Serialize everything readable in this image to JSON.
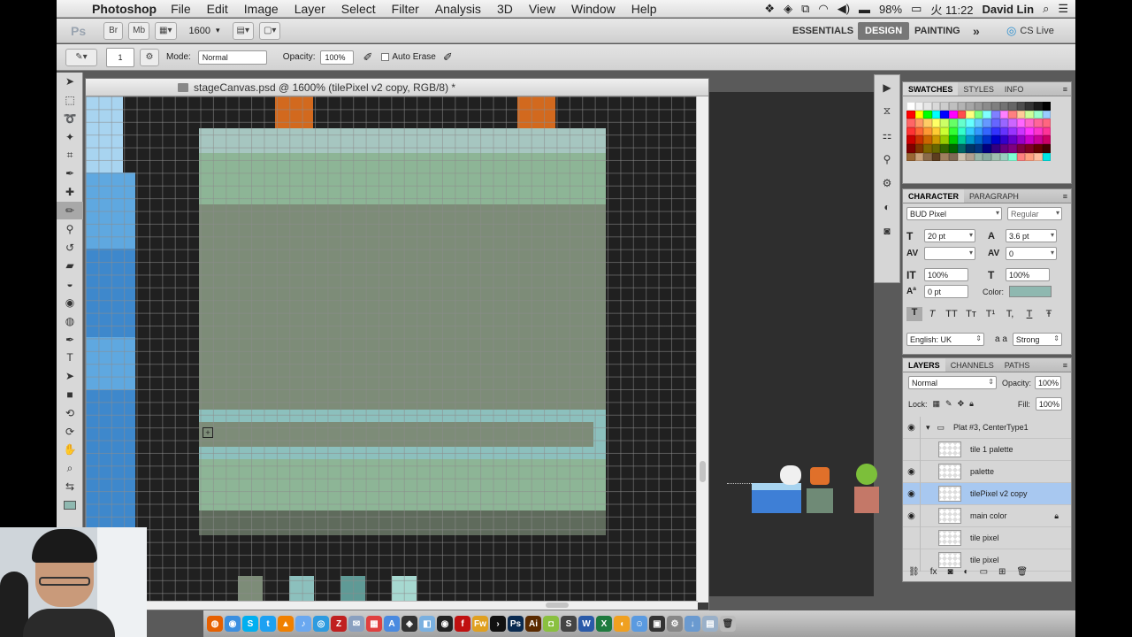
{
  "menubar": {
    "app": "Photoshop",
    "items": [
      "File",
      "Edit",
      "Image",
      "Layer",
      "Select",
      "Filter",
      "Analysis",
      "3D",
      "View",
      "Window",
      "Help"
    ],
    "battery": "98%",
    "clock": "火 11:22",
    "user": "David Lin"
  },
  "appbar": {
    "logo": "Ps",
    "br": "Br",
    "mb": "Mb",
    "zoom": "1600",
    "workspaces": [
      "ESSENTIALS",
      "DESIGN",
      "PAINTING"
    ],
    "more": "»",
    "cslive": "CS Live"
  },
  "options": {
    "brush_size": "1",
    "mode_label": "Mode:",
    "mode_value": "Normal",
    "opacity_label": "Opacity:",
    "opacity_value": "100%",
    "auto_erase": "Auto Erase"
  },
  "document": {
    "title": "stageCanvas.psd @ 1600% (tilePixel v2 copy, RGB/8) *"
  },
  "swatches_panel": {
    "tabs": [
      "SWATCHES",
      "STYLES",
      "INFO"
    ],
    "colors": [
      "#ffffff",
      "#f2f2f2",
      "#e6e6e6",
      "#d9d9d9",
      "#cccccc",
      "#bfbfbf",
      "#b3b3b3",
      "#a6a6a6",
      "#999999",
      "#8c8c8c",
      "#7f7f7f",
      "#737373",
      "#666666",
      "#4d4d4d",
      "#333333",
      "#1a1a1a",
      "#000000",
      "#ff0000",
      "#ffff00",
      "#00ff00",
      "#00ffff",
      "#0000ff",
      "#ff00ff",
      "#ff4d4d",
      "#ffff80",
      "#80ff80",
      "#80ffff",
      "#8080ff",
      "#ff80ff",
      "#ff8080",
      "#ffcc99",
      "#ccff99",
      "#99ffcc",
      "#99ccff",
      "#ff6666",
      "#ff9966",
      "#ffcc66",
      "#ffff66",
      "#ccff66",
      "#66ff66",
      "#66ffcc",
      "#66ffff",
      "#66ccff",
      "#6699ff",
      "#6666ff",
      "#9966ff",
      "#cc66ff",
      "#ff66ff",
      "#ff66cc",
      "#ff6699",
      "#ff6680",
      "#ff3333",
      "#ff6633",
      "#ff9933",
      "#ffcc33",
      "#ccff33",
      "#33ff33",
      "#33ffcc",
      "#33ccff",
      "#3399ff",
      "#3366ff",
      "#3333ff",
      "#6633ff",
      "#9933ff",
      "#cc33ff",
      "#ff33ff",
      "#ff33cc",
      "#ff3399",
      "#cc0000",
      "#cc3300",
      "#cc6600",
      "#cc9900",
      "#99cc00",
      "#00cc00",
      "#00cc99",
      "#0099cc",
      "#0066cc",
      "#0033cc",
      "#0000cc",
      "#3300cc",
      "#6600cc",
      "#9900cc",
      "#cc00cc",
      "#cc0099",
      "#cc0066",
      "#800000",
      "#803300",
      "#806600",
      "#666600",
      "#336600",
      "#006600",
      "#006666",
      "#003366",
      "#003380",
      "#000080",
      "#330080",
      "#660080",
      "#800080",
      "#800040",
      "#800020",
      "#660000",
      "#400000",
      "#996633",
      "#c9a27a",
      "#8b6b4a",
      "#5c3d1e",
      "#a08060",
      "#7f6a55",
      "#cfc2b0",
      "#b0a090",
      "#97b5a9",
      "#88aaa0",
      "#a0c0b0",
      "#9ad0c0",
      "#7fffd4",
      "#ff7f7f",
      "#ff9f7f",
      "#ffbfa0",
      "#00e5e5"
    ]
  },
  "character_panel": {
    "tabs": [
      "CHARACTER",
      "PARAGRAPH"
    ],
    "font_family": "BUD Pixel",
    "font_style": "Regular",
    "font_size": "20 pt",
    "leading": "3.6 pt",
    "kerning": "",
    "tracking": "0",
    "vscale": "100%",
    "hscale": "100%",
    "baseline": "0 pt",
    "color_label": "Color:",
    "color_value": "#8fb8b0",
    "style_buttons": [
      "T",
      "T",
      "TT",
      "Tт",
      "T¹",
      "T,",
      "T",
      "Ŧ"
    ],
    "language": "English: UK",
    "aa_label": "a a",
    "aa_value": "Strong"
  },
  "layers_panel": {
    "tabs": [
      "LAYERS",
      "CHANNELS",
      "PATHS"
    ],
    "blend": "Normal",
    "opacity_label": "Opacity:",
    "opacity": "100%",
    "lock_label": "Lock:",
    "fill_label": "Fill:",
    "fill": "100%",
    "group": "Plat #3, CenterType1",
    "layers": [
      {
        "name": "tile 1 palette",
        "visible": false,
        "selected": false
      },
      {
        "name": "palette",
        "visible": true,
        "selected": false
      },
      {
        "name": "tilePixel v2 copy",
        "visible": true,
        "selected": true
      },
      {
        "name": "main color",
        "visible": true,
        "selected": false
      },
      {
        "name": "tile pixel",
        "visible": false,
        "selected": false
      },
      {
        "name": "tile pixel",
        "visible": false,
        "selected": false
      }
    ]
  },
  "canvas_colors": {
    "background": "#202020",
    "teal_top": "#8fb8b0",
    "green": "#8db596",
    "grey_green": "#7d8c78",
    "teal_band": "#8cc0bd",
    "dark_band": "#5f6b5c",
    "orange": "#d2691e",
    "blue_light": "#a8d4f0",
    "blue_mid": "#5fa8e0",
    "blue_dark": "#3e88cc"
  }
}
